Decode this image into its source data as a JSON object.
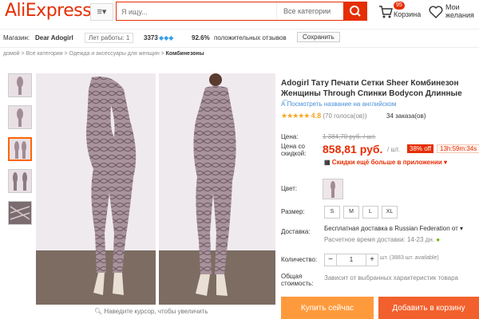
{
  "header": {
    "logo": "AliExpress",
    "menu_icon": "≡▾",
    "search_placeholder": "Я ищу...",
    "search_category": "Все категории",
    "cart_count": "95",
    "cart_label": "Корзина",
    "wishlist_label_1": "Мои",
    "wishlist_label_2": "желания"
  },
  "store": {
    "label": "Магазин:",
    "name": "Dear Adogirl",
    "years": "Лет работы: 1",
    "score": "3373",
    "positive_pct": "92.6%",
    "positive_text": "положительных отзывов",
    "follow_label": "Сохранить"
  },
  "breadcrumb": {
    "path": "домой  >  Все категории  >  Одежда и аксессуары для женщин  > ",
    "current": "Комбинезоны"
  },
  "gallery": {
    "zoom_hint": "Наведите курсор, чтобы увеличить"
  },
  "product": {
    "title": "Adogirl Тату Печати Сетки Sheer Комбинезон Женщины Through Спинки Bodycon Длинные Rompers Combinaison",
    "translate_link": "Посмотреть название на английском",
    "stars": "★★★★★",
    "rating": "4.8",
    "reviews": "(70 голоса(ов))",
    "orders": "34 заказа(ов)"
  },
  "price": {
    "label_price": "Цена:",
    "old_price": "1 384,70 руб. / шт.",
    "label_discount_1": "Цена со",
    "label_discount_2": "скидкой:",
    "new_price": "858,81 руб.",
    "per_unit": "/ шт.",
    "discount_badge": "38% off",
    "timer": "13h:59m:34s",
    "app_promo": "Скидки ещё больше в приложении ▾"
  },
  "options": {
    "color_label": "Цвет:",
    "size_label": "Размер:",
    "sizes": [
      "S",
      "M",
      "L",
      "XL"
    ],
    "shipping_label": "Доставка:",
    "shipping_text": "Бесплатная доставка в Russian Federation от",
    "delivery_time": "Расчетное время доставки: 14-23 дн.",
    "qty_label": "Количество:",
    "qty_value": "1",
    "qty_minus": "−",
    "qty_plus": "+",
    "stock": "шт. (3883 шт. available)",
    "total_label_1": "Общая",
    "total_label_2": "стоимость:",
    "total_note": "Зависит от выбранных характеристик товара"
  },
  "actions": {
    "buy_now": "Купить сейчас",
    "add_to_cart": "Добавить в корзину"
  },
  "colors": {
    "accent": "#e62e04",
    "buy": "#ff9a3c",
    "cart": "#f2612d"
  }
}
